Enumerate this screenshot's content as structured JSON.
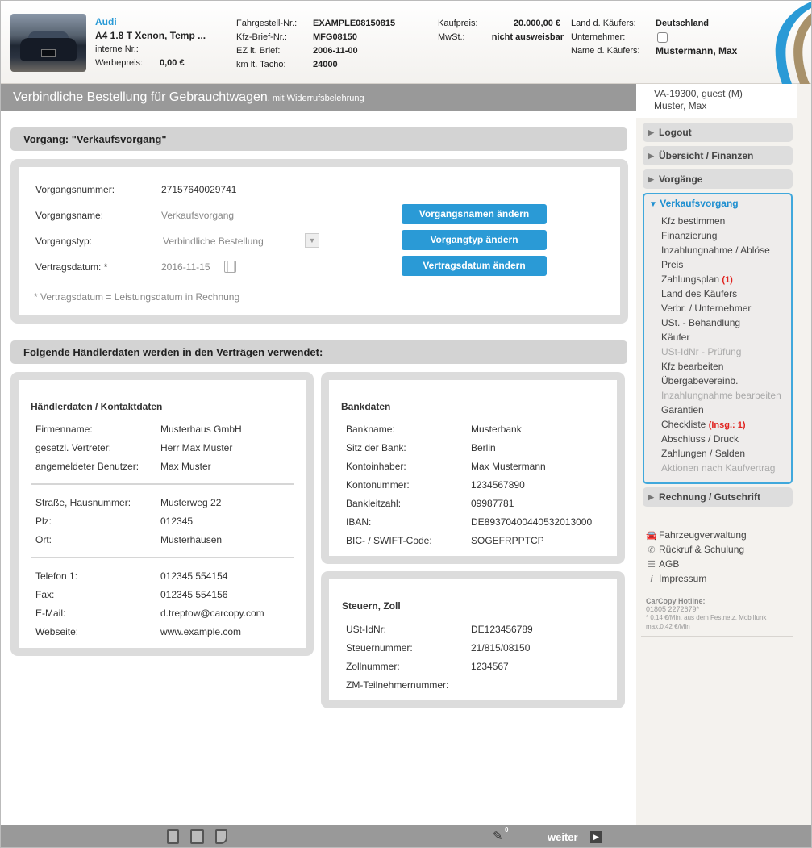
{
  "vehicle": {
    "brand": "Audi",
    "model": "A4 1.8 T Xenon, Temp ...",
    "internal_nr_label": "interne Nr.:",
    "internal_nr_value": "",
    "ad_price_label": "Werbepreis:",
    "ad_price_value": "0,00 €",
    "vin_label": "Fahrgestell-Nr.:",
    "vin_value": "EXAMPLE08150815",
    "reg_doc_label": "Kfz-Brief-Nr.:",
    "reg_doc_value": "MFG08150",
    "first_reg_label": "EZ lt. Brief:",
    "first_reg_value": "2006-11-00",
    "mileage_label": "km lt. Tacho:",
    "mileage_value": "24000",
    "purchase_price_label": "Kaufpreis:",
    "purchase_price_value": "20.000,00 €",
    "vat_label": "MwSt.:",
    "vat_value": "nicht ausweisbar",
    "buyer_country_label": "Land d. Käufers:",
    "buyer_country_value": "Deutschland",
    "company_label": "Unternehmer:",
    "buyer_name_label": "Name d. Käufers:",
    "buyer_name_value": "Mustermann, Max"
  },
  "title": {
    "main": "Verbindliche Bestellung für Gebrauchtwagen",
    "suffix": ", mit Widerrufsbelehrung"
  },
  "user": {
    "line1": "VA-19300, guest (M)",
    "line2": "Muster, Max"
  },
  "nav": {
    "logout": "Logout",
    "overview": "Übersicht / Finanzen",
    "processes": "Vorgänge",
    "open_section": "Verkaufsvorgang",
    "items": [
      {
        "label": "Kfz bestimmen",
        "count": "",
        "disabled": false
      },
      {
        "label": "Finanzierung",
        "count": "",
        "disabled": false
      },
      {
        "label": "Inzahlungnahme / Ablöse",
        "count": "",
        "disabled": false
      },
      {
        "label": "Preis",
        "count": "",
        "disabled": false
      },
      {
        "label": "Zahlungsplan",
        "count": "(1)",
        "disabled": false
      },
      {
        "label": "Land des Käufers",
        "count": "",
        "disabled": false
      },
      {
        "label": "Verbr. / Unternehmer",
        "count": "",
        "disabled": false
      },
      {
        "label": "USt. - Behandlung",
        "count": "",
        "disabled": false
      },
      {
        "label": "Käufer",
        "count": "",
        "disabled": false
      },
      {
        "label": "USt-IdNr - Prüfung",
        "count": "",
        "disabled": true
      },
      {
        "label": "Kfz bearbeiten",
        "count": "",
        "disabled": false
      },
      {
        "label": "Übergabevereinb.",
        "count": "",
        "disabled": false
      },
      {
        "label": "Inzahlungnahme bearbeiten",
        "count": "",
        "disabled": true
      },
      {
        "label": "Garantien",
        "count": "",
        "disabled": false
      },
      {
        "label": "Checkliste",
        "count": "(Insg.: 1)",
        "disabled": false
      },
      {
        "label": "Abschluss / Druck",
        "count": "",
        "disabled": false
      },
      {
        "label": "Zahlungen / Salden",
        "count": "",
        "disabled": false
      },
      {
        "label": "Aktionen nach Kaufvertrag",
        "count": "",
        "disabled": true
      }
    ],
    "invoice": "Rechnung / Gutschrift",
    "footer_links": [
      {
        "label": "Fahrzeugverwaltung",
        "icon": "car-icon"
      },
      {
        "label": "Rückruf & Schulung",
        "icon": "phone-icon"
      },
      {
        "label": "AGB",
        "icon": "list-icon"
      },
      {
        "label": "Impressum",
        "icon": "info-icon"
      }
    ],
    "hotline_title": "CarCopy Hotline:",
    "hotline_number": "01805 2272679*",
    "hotline_note1": "* 0,14 €/Min. aus dem Festnetz, Mobilfunk",
    "hotline_note2": "max.0,42 €/Min"
  },
  "process": {
    "section_title": "Vorgang: \"Verkaufsvorgang\"",
    "number_label": "Vorgangsnummer:",
    "number_value": "27157640029741",
    "name_label": "Vorgangsname:",
    "name_value": "Verkaufsvorgang",
    "type_label": "Vorgangstyp:",
    "type_value": "Verbindliche Bestellung",
    "date_label": "Vertragsdatum: *",
    "date_value": "2016-11-15",
    "note": "* Vertragsdatum = Leistungsdatum in Rechnung",
    "btn_change_name": "Vorgangsnamen ändern",
    "btn_change_type": "Vorgangtyp ändern",
    "btn_change_date": "Vertragsdatum ändern"
  },
  "dealer": {
    "section_title": "Folgende Händlerdaten werden in den Verträgen verwendet:",
    "contact_title": "Händlerdaten / Kontaktdaten",
    "contact_group1": [
      {
        "label": "Firmenname:",
        "value": "Musterhaus GmbH"
      },
      {
        "label": "gesetzl. Vertreter:",
        "value": "Herr Max Muster"
      },
      {
        "label": "angemeldeter Benutzer:",
        "value": "Max Muster"
      }
    ],
    "contact_group2": [
      {
        "label": "Straße, Hausnummer:",
        "value": "Musterweg 22"
      },
      {
        "label": "Plz:",
        "value": "012345"
      },
      {
        "label": "Ort:",
        "value": "Musterhausen"
      }
    ],
    "contact_group3": [
      {
        "label": "Telefon 1:",
        "value": "012345 554154"
      },
      {
        "label": "Fax:",
        "value": "012345 554156"
      },
      {
        "label": "E-Mail:",
        "value": "d.treptow@carcopy.com"
      },
      {
        "label": "Webseite:",
        "value": "www.example.com"
      }
    ],
    "bank_title": "Bankdaten",
    "bank": [
      {
        "label": "Bankname:",
        "value": "Musterbank"
      },
      {
        "label": "Sitz der Bank:",
        "value": "Berlin"
      },
      {
        "label": "Kontoinhaber:",
        "value": "Max Mustermann"
      },
      {
        "label": "Kontonummer:",
        "value": "1234567890"
      },
      {
        "label": "Bankleitzahl:",
        "value": "09987781"
      },
      {
        "label": "IBAN:",
        "value": "DE89370400440532013000"
      },
      {
        "label": "BIC- / SWIFT-Code:",
        "value": "SOGEFRPPTCP"
      }
    ],
    "tax_title": "Steuern, Zoll",
    "tax": [
      {
        "label": "USt-IdNr:",
        "value": "DE123456789"
      },
      {
        "label": "Steuernummer:",
        "value": "21/815/08150"
      },
      {
        "label": "Zollnummer:",
        "value": "1234567"
      },
      {
        "label": "ZM-Teilnehmernummer:",
        "value": ""
      }
    ]
  },
  "bottom": {
    "edit_count": "0",
    "next_label": "weiter"
  },
  "colors": {
    "accent": "#2a9ad6",
    "title_bar": "#999999",
    "count_red": "#e0221e"
  }
}
